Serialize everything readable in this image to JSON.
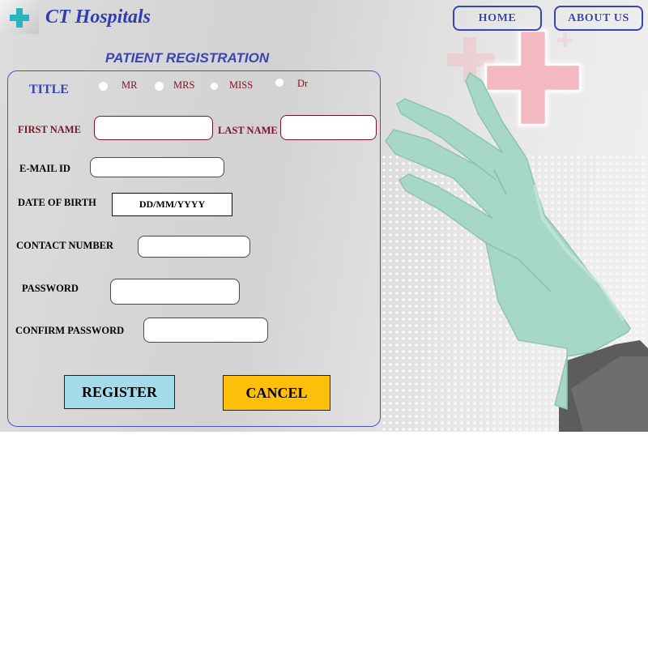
{
  "header": {
    "brand": "CT Hospitals",
    "nav": {
      "home": "HOME",
      "about": "ABOUT US"
    }
  },
  "page_title": "PATIENT REGISTRATION",
  "form": {
    "title_label": "TITLE",
    "title_options": [
      "MR",
      "MRS",
      "MISS",
      "Dr"
    ],
    "first_name_label": "FIRST NAME",
    "last_name_label": "LAST NAME",
    "email_label": "E-MAIL ID",
    "dob_label": "DATE OF BIRTH",
    "dob_placeholder": "DD/MM/YYYY",
    "contact_label": "CONTACT NUMBER",
    "password_label": "PASSWORD",
    "confirm_password_label": "CONFIRM PASSWORD",
    "register_label": "REGISTER",
    "cancel_label": "CANCEL"
  },
  "icons": {
    "logo": "medical-cross-icon",
    "hero": "gloved-hand-image"
  },
  "colors": {
    "brand_blue": "#2f3db4",
    "label_red": "#7a1424",
    "register_bg": "#a3dbea",
    "cancel_bg": "#fcc00a",
    "logo_cross": "#2bb3c0",
    "glove": "#a7d8c6"
  }
}
